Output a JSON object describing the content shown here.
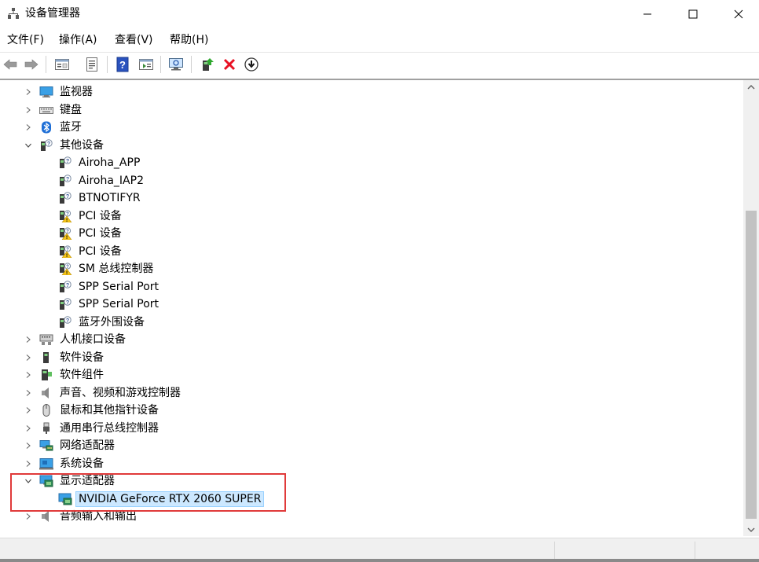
{
  "window": {
    "title": "设备管理器"
  },
  "menu": {
    "items": [
      "文件(F)",
      "操作(A)",
      "查看(V)",
      "帮助(H)"
    ]
  },
  "toolbar": {
    "buttons": [
      "back-icon",
      "forward-icon",
      "properties-view-icon",
      "driver-details-icon",
      "help-icon",
      "show-hidden-icon",
      "scan-hardware-icon",
      "update-driver-icon",
      "uninstall-icon",
      "disable-device-icon"
    ]
  },
  "tree": {
    "nodes": [
      {
        "label": "监视器",
        "icon": "monitor-icon",
        "expander": "›"
      },
      {
        "label": "键盘",
        "icon": "keyboard-icon",
        "expander": "›"
      },
      {
        "label": "蓝牙",
        "icon": "bluetooth-icon",
        "expander": "›"
      },
      {
        "label": "其他设备",
        "icon": "unknown-device-icon",
        "expander": "⌄"
      },
      {
        "label": "Airoha_APP",
        "icon": "unknown-device-icon"
      },
      {
        "label": "Airoha_IAP2",
        "icon": "unknown-device-icon"
      },
      {
        "label": "BTNOTIFYR",
        "icon": "unknown-device-icon"
      },
      {
        "label": "PCI 设备",
        "icon": "warning-device-icon"
      },
      {
        "label": "PCI 设备",
        "icon": "warning-device-icon"
      },
      {
        "label": "PCI 设备",
        "icon": "warning-device-icon"
      },
      {
        "label": "SM 总线控制器",
        "icon": "warning-device-icon"
      },
      {
        "label": "SPP Serial Port",
        "icon": "unknown-device-icon"
      },
      {
        "label": "SPP Serial Port",
        "icon": "unknown-device-icon"
      },
      {
        "label": "蓝牙外围设备",
        "icon": "unknown-device-icon"
      },
      {
        "label": "人机接口设备",
        "icon": "hid-icon",
        "expander": "›"
      },
      {
        "label": "软件设备",
        "icon": "software-device-icon",
        "expander": "›"
      },
      {
        "label": "软件组件",
        "icon": "software-component-icon",
        "expander": "›"
      },
      {
        "label": "声音、视频和游戏控制器",
        "icon": "speaker-icon",
        "expander": "›"
      },
      {
        "label": "鼠标和其他指针设备",
        "icon": "mouse-icon",
        "expander": "›"
      },
      {
        "label": "通用串行总线控制器",
        "icon": "usb-icon",
        "expander": "›"
      },
      {
        "label": "网络适配器",
        "icon": "network-icon",
        "expander": "›"
      },
      {
        "label": "系统设备",
        "icon": "system-device-icon",
        "expander": "›"
      },
      {
        "label": "显示适配器",
        "icon": "display-adapter-icon",
        "expander": "⌄"
      },
      {
        "label": "NVIDIA GeForce RTX 2060 SUPER",
        "icon": "display-adapter-icon",
        "selected": true
      },
      {
        "label": "音频输入和输出",
        "icon": "audio-io-icon",
        "expander": "›"
      }
    ]
  },
  "colors": {
    "selection_bg": "#cce8ff",
    "highlight_border": "#e03a3a",
    "warning": "#f5c518",
    "delete": "#e81123"
  }
}
